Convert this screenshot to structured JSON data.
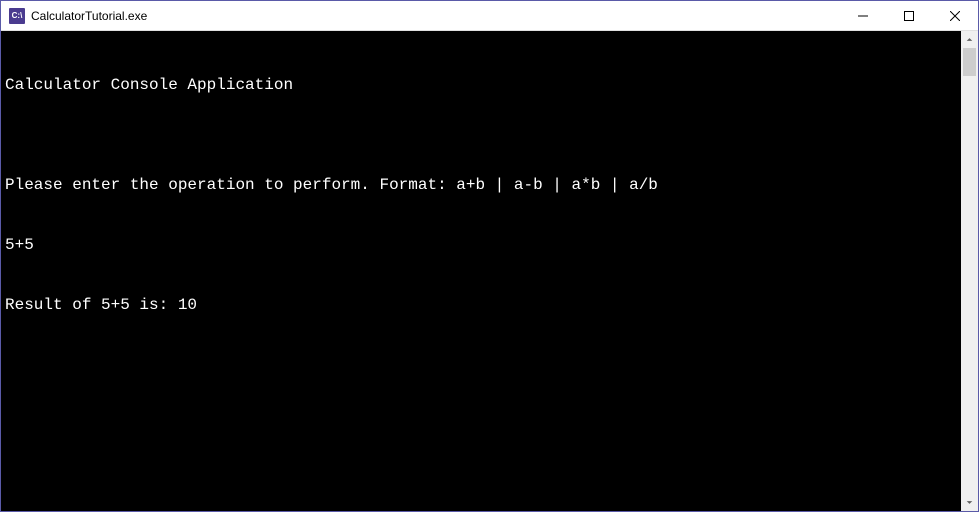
{
  "window": {
    "title": "CalculatorTutorial.exe",
    "icon_label": "C:\\"
  },
  "console": {
    "lines": [
      "Calculator Console Application",
      "",
      "Please enter the operation to perform. Format: a+b | a-b | a*b | a/b",
      "5+5",
      "Result of 5+5 is: 10"
    ]
  }
}
